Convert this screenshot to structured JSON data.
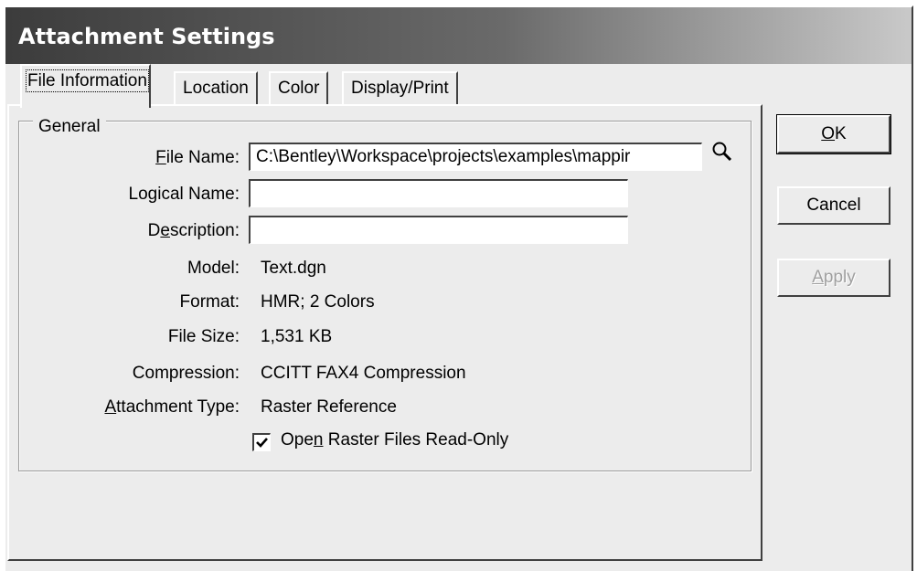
{
  "window": {
    "title": "Attachment Settings"
  },
  "tabs": [
    {
      "label": "File Information",
      "active": true
    },
    {
      "label": "Location",
      "active": false
    },
    {
      "label": "Color",
      "active": false
    },
    {
      "label": "Display/Print",
      "active": false
    }
  ],
  "general": {
    "group_title": "General",
    "file_name": {
      "label": "File Name:",
      "value": "C:\\Bentley\\Workspace\\projects\\examples\\mappir"
    },
    "logical_name": {
      "label": "Logical Name:",
      "value": ""
    },
    "description": {
      "label": "Description:",
      "value": ""
    },
    "model": {
      "label": "Model:",
      "value": "Text.dgn"
    },
    "format": {
      "label": "Format:",
      "value": "HMR; 2 Colors"
    },
    "file_size": {
      "label": "File Size:",
      "value": "1,531 KB"
    },
    "compression": {
      "label": "Compression:",
      "value": "CCITT FAX4 Compression"
    },
    "attachment_type": {
      "label": "Attachment Type:",
      "value": "Raster Reference"
    },
    "read_only": {
      "label": "Open Raster Files Read-Only",
      "checked": true
    }
  },
  "buttons": {
    "ok": "OK",
    "cancel": "Cancel",
    "apply": "Apply"
  },
  "icons": {
    "browse": "magnifier-icon",
    "check": "checkmark-icon"
  }
}
